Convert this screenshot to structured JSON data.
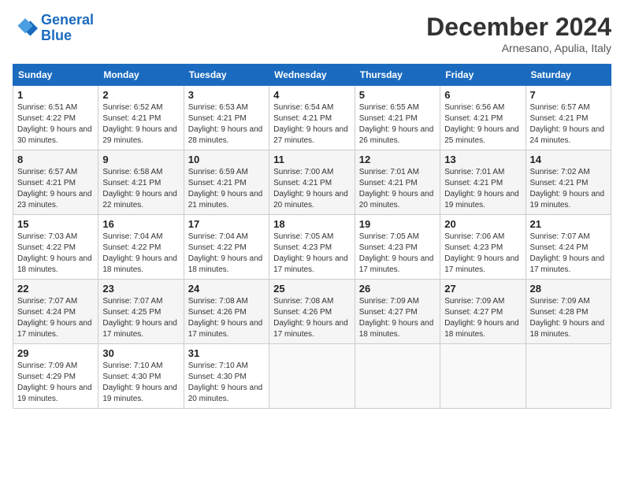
{
  "header": {
    "logo_line1": "General",
    "logo_line2": "Blue",
    "month": "December 2024",
    "location": "Arnesano, Apulia, Italy"
  },
  "weekdays": [
    "Sunday",
    "Monday",
    "Tuesday",
    "Wednesday",
    "Thursday",
    "Friday",
    "Saturday"
  ],
  "weeks": [
    [
      {
        "day": "1",
        "sunrise": "6:51 AM",
        "sunset": "4:22 PM",
        "daylight": "9 hours and 30 minutes."
      },
      {
        "day": "2",
        "sunrise": "6:52 AM",
        "sunset": "4:21 PM",
        "daylight": "9 hours and 29 minutes."
      },
      {
        "day": "3",
        "sunrise": "6:53 AM",
        "sunset": "4:21 PM",
        "daylight": "9 hours and 28 minutes."
      },
      {
        "day": "4",
        "sunrise": "6:54 AM",
        "sunset": "4:21 PM",
        "daylight": "9 hours and 27 minutes."
      },
      {
        "day": "5",
        "sunrise": "6:55 AM",
        "sunset": "4:21 PM",
        "daylight": "9 hours and 26 minutes."
      },
      {
        "day": "6",
        "sunrise": "6:56 AM",
        "sunset": "4:21 PM",
        "daylight": "9 hours and 25 minutes."
      },
      {
        "day": "7",
        "sunrise": "6:57 AM",
        "sunset": "4:21 PM",
        "daylight": "9 hours and 24 minutes."
      }
    ],
    [
      {
        "day": "8",
        "sunrise": "6:57 AM",
        "sunset": "4:21 PM",
        "daylight": "9 hours and 23 minutes."
      },
      {
        "day": "9",
        "sunrise": "6:58 AM",
        "sunset": "4:21 PM",
        "daylight": "9 hours and 22 minutes."
      },
      {
        "day": "10",
        "sunrise": "6:59 AM",
        "sunset": "4:21 PM",
        "daylight": "9 hours and 21 minutes."
      },
      {
        "day": "11",
        "sunrise": "7:00 AM",
        "sunset": "4:21 PM",
        "daylight": "9 hours and 20 minutes."
      },
      {
        "day": "12",
        "sunrise": "7:01 AM",
        "sunset": "4:21 PM",
        "daylight": "9 hours and 20 minutes."
      },
      {
        "day": "13",
        "sunrise": "7:01 AM",
        "sunset": "4:21 PM",
        "daylight": "9 hours and 19 minutes."
      },
      {
        "day": "14",
        "sunrise": "7:02 AM",
        "sunset": "4:21 PM",
        "daylight": "9 hours and 19 minutes."
      }
    ],
    [
      {
        "day": "15",
        "sunrise": "7:03 AM",
        "sunset": "4:22 PM",
        "daylight": "9 hours and 18 minutes."
      },
      {
        "day": "16",
        "sunrise": "7:04 AM",
        "sunset": "4:22 PM",
        "daylight": "9 hours and 18 minutes."
      },
      {
        "day": "17",
        "sunrise": "7:04 AM",
        "sunset": "4:22 PM",
        "daylight": "9 hours and 18 minutes."
      },
      {
        "day": "18",
        "sunrise": "7:05 AM",
        "sunset": "4:23 PM",
        "daylight": "9 hours and 17 minutes."
      },
      {
        "day": "19",
        "sunrise": "7:05 AM",
        "sunset": "4:23 PM",
        "daylight": "9 hours and 17 minutes."
      },
      {
        "day": "20",
        "sunrise": "7:06 AM",
        "sunset": "4:23 PM",
        "daylight": "9 hours and 17 minutes."
      },
      {
        "day": "21",
        "sunrise": "7:07 AM",
        "sunset": "4:24 PM",
        "daylight": "9 hours and 17 minutes."
      }
    ],
    [
      {
        "day": "22",
        "sunrise": "7:07 AM",
        "sunset": "4:24 PM",
        "daylight": "9 hours and 17 minutes."
      },
      {
        "day": "23",
        "sunrise": "7:07 AM",
        "sunset": "4:25 PM",
        "daylight": "9 hours and 17 minutes."
      },
      {
        "day": "24",
        "sunrise": "7:08 AM",
        "sunset": "4:26 PM",
        "daylight": "9 hours and 17 minutes."
      },
      {
        "day": "25",
        "sunrise": "7:08 AM",
        "sunset": "4:26 PM",
        "daylight": "9 hours and 17 minutes."
      },
      {
        "day": "26",
        "sunrise": "7:09 AM",
        "sunset": "4:27 PM",
        "daylight": "9 hours and 18 minutes."
      },
      {
        "day": "27",
        "sunrise": "7:09 AM",
        "sunset": "4:27 PM",
        "daylight": "9 hours and 18 minutes."
      },
      {
        "day": "28",
        "sunrise": "7:09 AM",
        "sunset": "4:28 PM",
        "daylight": "9 hours and 18 minutes."
      }
    ],
    [
      {
        "day": "29",
        "sunrise": "7:09 AM",
        "sunset": "4:29 PM",
        "daylight": "9 hours and 19 minutes."
      },
      {
        "day": "30",
        "sunrise": "7:10 AM",
        "sunset": "4:30 PM",
        "daylight": "9 hours and 19 minutes."
      },
      {
        "day": "31",
        "sunrise": "7:10 AM",
        "sunset": "4:30 PM",
        "daylight": "9 hours and 20 minutes."
      },
      null,
      null,
      null,
      null
    ]
  ]
}
